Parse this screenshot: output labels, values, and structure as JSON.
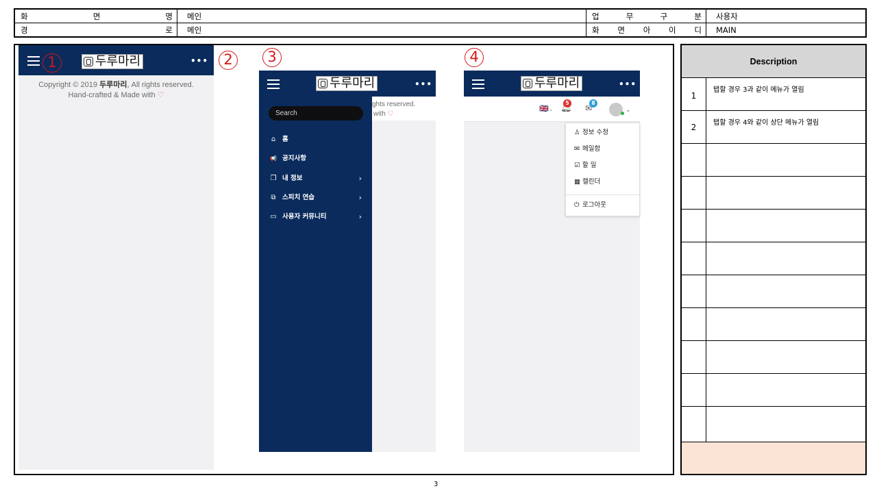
{
  "header": {
    "row1": {
      "label1": [
        "화",
        "면",
        "명"
      ],
      "value1": "메인",
      "label2": [
        "업",
        "무",
        "구",
        "분"
      ],
      "value2": "사용자"
    },
    "row2": {
      "label1": [
        "경",
        "로"
      ],
      "value1": "메인",
      "label2": [
        "화",
        "면",
        "아",
        "이",
        "디"
      ],
      "value2": "MAIN"
    }
  },
  "markers": [
    "1",
    "2",
    "3",
    "4"
  ],
  "app": {
    "logo_text": "두루마리",
    "more_icon": "•••",
    "copyright_line1_pre": "Copyright © 2019 ",
    "copyright_brand": "두루마리",
    "copyright_line1_post": ", All rights reserved.",
    "copyright_line2": "Hand-crafted & Made with",
    "heart": "♡",
    "partial_copy_1": "ghts reserved.",
    "partial_copy_2": "with"
  },
  "sidebar": {
    "search_placeholder": "Search",
    "items": [
      {
        "label": "홈",
        "icon": "home-icon",
        "glyph": "⌂",
        "has_chevron": false
      },
      {
        "label": "공지사항",
        "icon": "megaphone-icon",
        "glyph": "📢",
        "has_chevron": false
      },
      {
        "label": "내 정보",
        "icon": "copy-icon",
        "glyph": "❐",
        "has_chevron": true
      },
      {
        "label": "스피치 연습",
        "icon": "briefcase-icon",
        "glyph": "⧉",
        "has_chevron": true
      },
      {
        "label": "사용자 커뮤니티",
        "icon": "window-icon",
        "glyph": "▭",
        "has_chevron": true
      }
    ],
    "chevron": "›"
  },
  "topbar": {
    "flag": "🇬🇧",
    "notif_count": "5",
    "mail_count": "8",
    "colors": {
      "notif_badge": "#e03131",
      "mail_badge": "#2f9fd9",
      "status_dot": "#2fb344"
    }
  },
  "user_menu": [
    {
      "label": "정보 수정",
      "icon": "user-icon",
      "glyph": "♙"
    },
    {
      "label": "메일함",
      "icon": "mail-icon",
      "glyph": "✉"
    },
    {
      "label": "할 일",
      "icon": "clipboard-icon",
      "glyph": "☑"
    },
    {
      "label": "캘린더",
      "icon": "calendar-icon",
      "glyph": "▦"
    },
    {
      "label": "로그아웃",
      "icon": "power-icon",
      "glyph": "⏻"
    }
  ],
  "description": {
    "title": "Description",
    "rows": [
      {
        "num": "1",
        "text": "탭할 경우 3과 같이 메뉴가 열림"
      },
      {
        "num": "2",
        "text": "탭할 경우 4와 같이 상단 메뉴가 열림"
      }
    ]
  },
  "page_number": "3",
  "colors": {
    "navy": "#0a2b5c",
    "marker_red": "#d41616",
    "last_row": "#fbe4d5"
  }
}
